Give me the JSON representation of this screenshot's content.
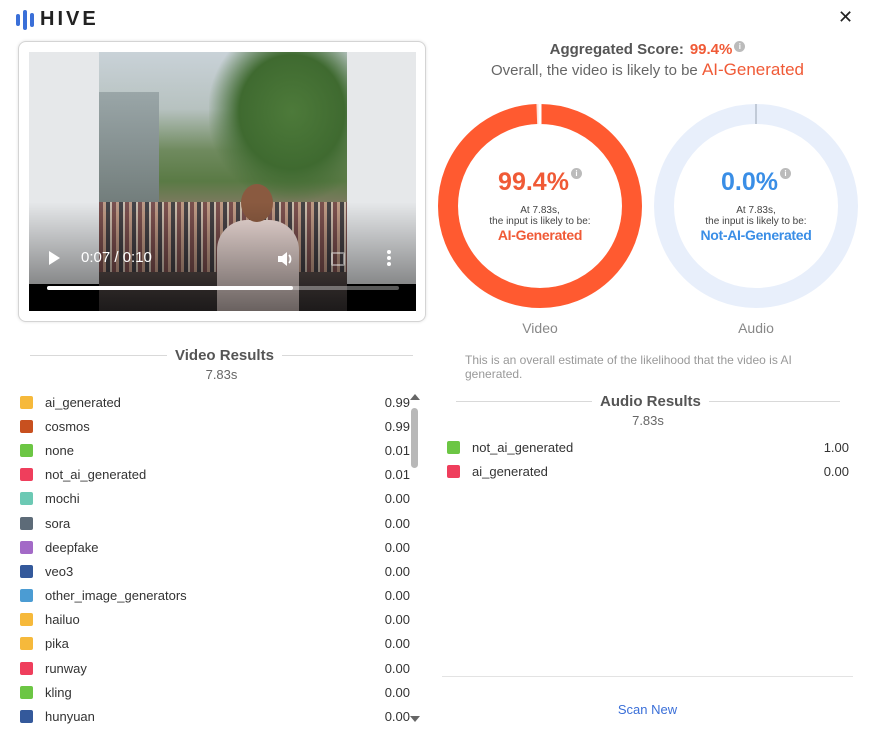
{
  "app": {
    "name": "HIVE",
    "close_icon": "close-icon"
  },
  "player": {
    "time": "0:07 / 0:10",
    "progress": 0.7,
    "icons": [
      "play-icon",
      "volume-icon",
      "fullscreen-icon",
      "more-options-icon"
    ]
  },
  "aggregate": {
    "label": "Aggregated Score:",
    "score": "99.4%",
    "overall_text": "Overall, the video is likely to be",
    "verdict": "AI-Generated"
  },
  "donuts": [
    {
      "pct": "99.4%",
      "fraction": 0.994,
      "note1": "At 7.83s,",
      "note2": "the input is likely to be:",
      "verdict": "AI-Generated",
      "label": "Video",
      "color": "#ff5a30",
      "track": "#fde2da"
    },
    {
      "pct": "0.0%",
      "fraction": 0.0,
      "note1": "At 7.83s,",
      "note2": "the input is likely to be:",
      "verdict": "Not-AI-Generated",
      "label": "Audio",
      "color": "#3a8ee6",
      "track": "#e8effb"
    }
  ],
  "estimate_text": "This is an overall estimate of the likelihood that the video is AI generated.",
  "video_results": {
    "title": "Video Results",
    "time": "7.83s",
    "items": [
      {
        "label": "ai_generated",
        "value": "0.99",
        "color": "#f6b93b"
      },
      {
        "label": "cosmos",
        "value": "0.99",
        "color": "#c8501f"
      },
      {
        "label": "none",
        "value": "0.01",
        "color": "#6cc644"
      },
      {
        "label": "not_ai_generated",
        "value": "0.01",
        "color": "#ef3e5c"
      },
      {
        "label": "mochi",
        "value": "0.00",
        "color": "#6cc9b4"
      },
      {
        "label": "sora",
        "value": "0.00",
        "color": "#5d6b78"
      },
      {
        "label": "deepfake",
        "value": "0.00",
        "color": "#a36ac7"
      },
      {
        "label": "veo3",
        "value": "0.00",
        "color": "#34599b"
      },
      {
        "label": "other_image_generators",
        "value": "0.00",
        "color": "#4b9cd3"
      },
      {
        "label": "hailuo",
        "value": "0.00",
        "color": "#f6b93b"
      },
      {
        "label": "pika",
        "value": "0.00",
        "color": "#f6b93b"
      },
      {
        "label": "runway",
        "value": "0.00",
        "color": "#ef3e5c"
      },
      {
        "label": "kling",
        "value": "0.00",
        "color": "#6cc644"
      },
      {
        "label": "hunyuan",
        "value": "0.00",
        "color": "#34599b"
      }
    ]
  },
  "audio_results": {
    "title": "Audio Results",
    "time": "7.83s",
    "items": [
      {
        "label": "not_ai_generated",
        "value": "1.00",
        "color": "#6cc644"
      },
      {
        "label": "ai_generated",
        "value": "0.00",
        "color": "#ef3e5c"
      }
    ]
  },
  "scan_new": "Scan New"
}
